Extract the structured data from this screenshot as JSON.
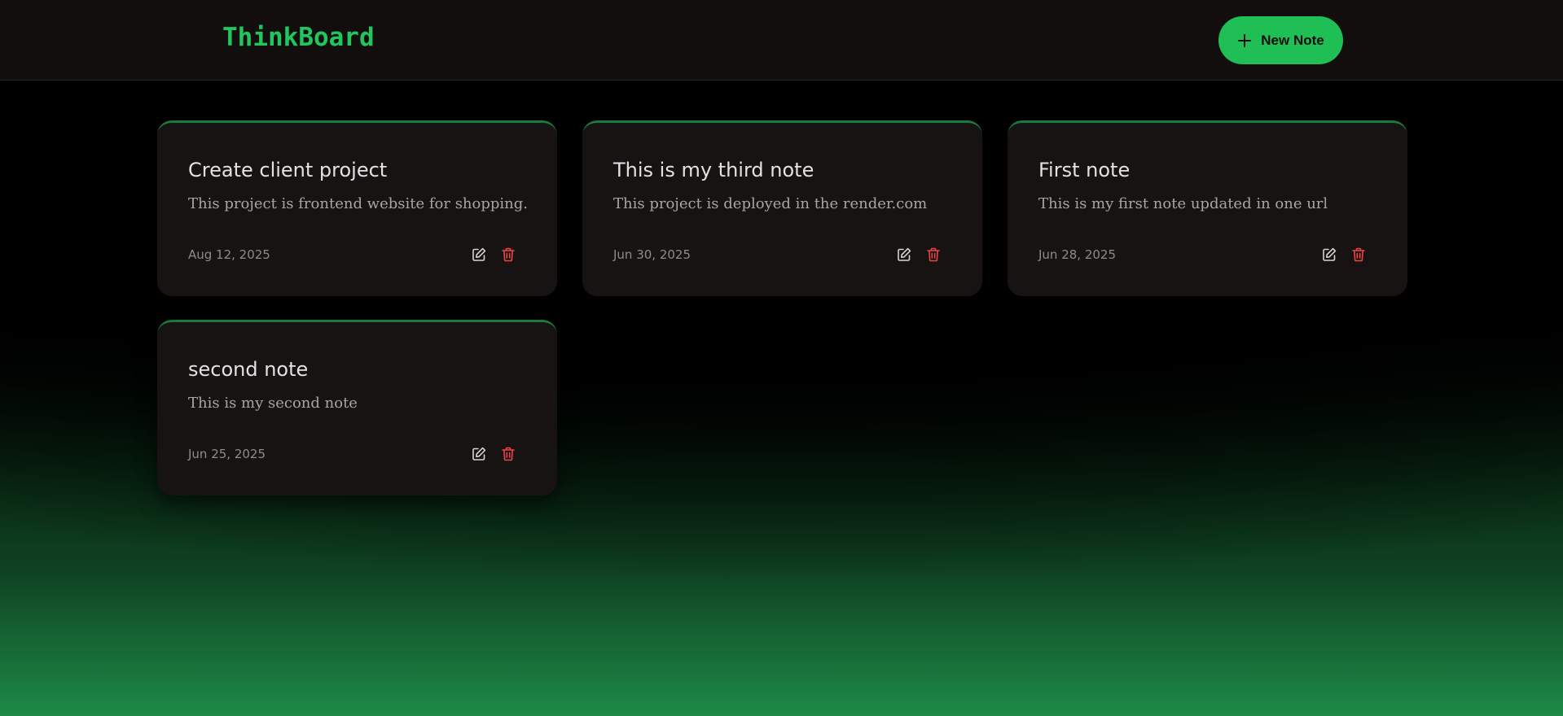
{
  "header": {
    "brand": "ThinkBoard",
    "new_note_label": "New Note",
    "new_note_icon": "plus-icon"
  },
  "colors": {
    "accent": "#22c55e",
    "button_bg": "#1fbf55",
    "card_bg": "#161312",
    "card_border_top": "#1a7a3d",
    "delete_icon": "#ef4444",
    "topbar_bg": "#110e0d"
  },
  "notes": [
    {
      "title": "Create client project",
      "content": "This project is frontend website for shopping.",
      "date": "Aug 12, 2025",
      "edit_icon": "edit-icon",
      "delete_icon": "trash-icon"
    },
    {
      "title": "This is my third note",
      "content": "This project is deployed in the render.com",
      "date": "Jun 30, 2025",
      "edit_icon": "edit-icon",
      "delete_icon": "trash-icon"
    },
    {
      "title": "First note",
      "content": "This is my first note updated in one url",
      "date": "Jun 28, 2025",
      "edit_icon": "edit-icon",
      "delete_icon": "trash-icon"
    },
    {
      "title": "second note",
      "content": "This is my second note",
      "date": "Jun 25, 2025",
      "edit_icon": "edit-icon",
      "delete_icon": "trash-icon"
    }
  ]
}
